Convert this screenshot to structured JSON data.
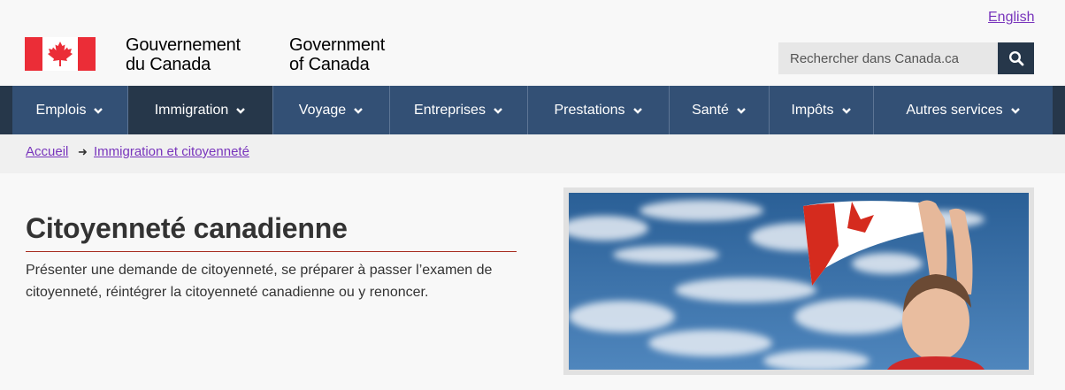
{
  "header": {
    "lang_link": "English",
    "signature_fr": [
      "Gouvernement",
      "du Canada"
    ],
    "signature_en": [
      "Government",
      "of Canada"
    ],
    "search": {
      "placeholder": "Rechercher dans Canada.ca",
      "button_icon": "search-icon"
    }
  },
  "nav": {
    "items": [
      {
        "label": "Emplois",
        "active": false
      },
      {
        "label": "Immigration",
        "active": true
      },
      {
        "label": "Voyage",
        "active": false
      },
      {
        "label": "Entreprises",
        "active": false
      },
      {
        "label": "Prestations",
        "active": false
      },
      {
        "label": "Santé",
        "active": false
      },
      {
        "label": "Impôts",
        "active": false
      },
      {
        "label": "Autres services",
        "active": false
      }
    ]
  },
  "breadcrumb": {
    "items": [
      "Accueil",
      "Immigration et citoyenneté"
    ]
  },
  "main": {
    "title": "Citoyenneté canadienne",
    "description": "Présenter une demande de citoyenneté, se préparer à passer l’examen de citoyenneté, réintégrer la citoyenneté canadienne ou y renoncer."
  },
  "colors": {
    "nav_bg": "#335075",
    "nav_active": "#26374a",
    "link": "#7834bc",
    "flag_red": "#eb2d37",
    "title_rule": "#a62a1e"
  }
}
